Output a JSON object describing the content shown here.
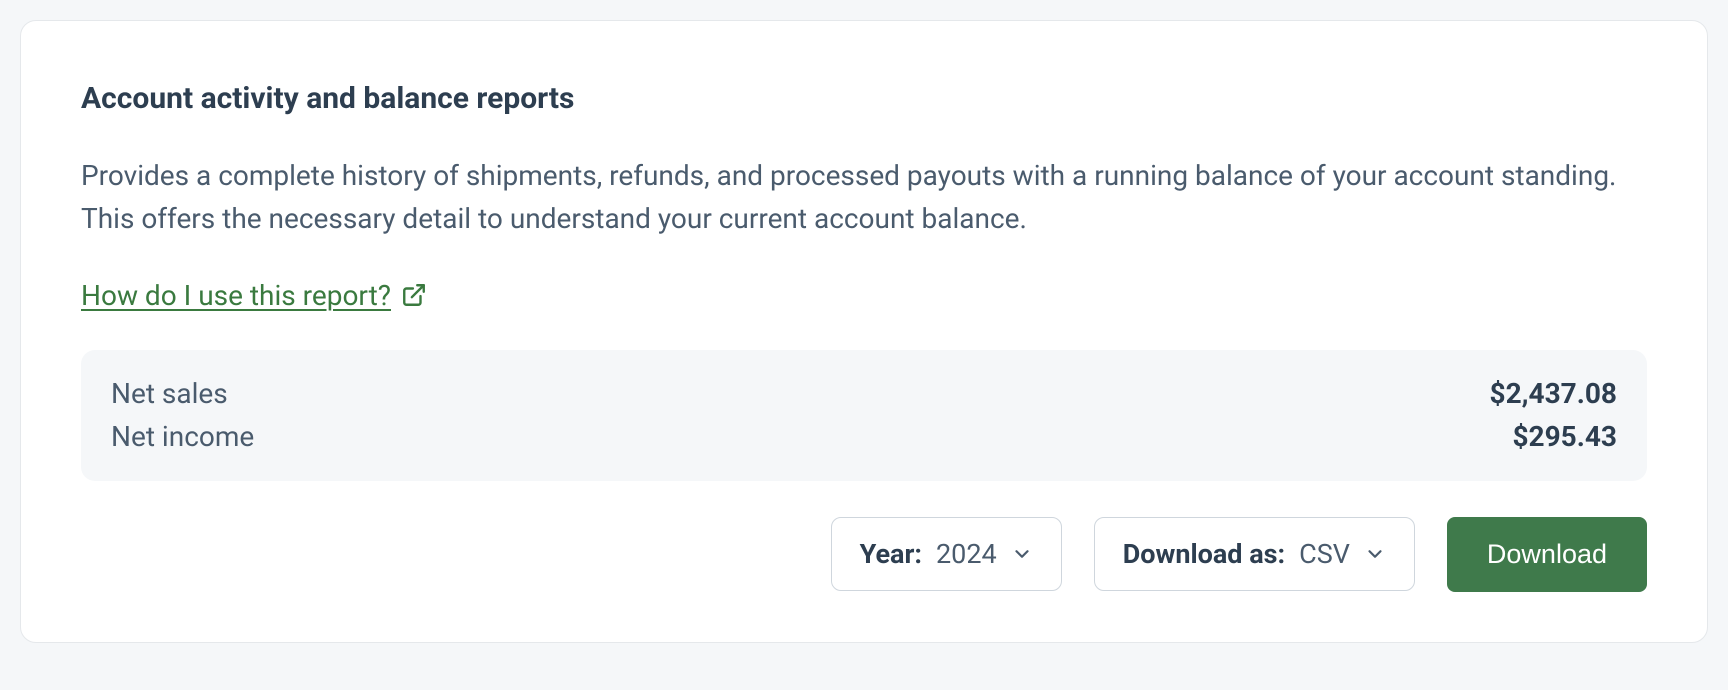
{
  "card": {
    "title": "Account activity and balance reports",
    "description": "Provides a complete history of shipments, refunds, and processed payouts with a running balance of your account standing. This offers the necessary detail to understand your current account balance.",
    "help_link_text": "How do I use this report?"
  },
  "stats": {
    "net_sales_label": "Net sales",
    "net_sales_value": "$2,437.08",
    "net_income_label": "Net income",
    "net_income_value": "$295.43"
  },
  "controls": {
    "year_label": "Year:",
    "year_value": "2024",
    "format_label": "Download as:",
    "format_value": "CSV",
    "download_button": "Download"
  }
}
